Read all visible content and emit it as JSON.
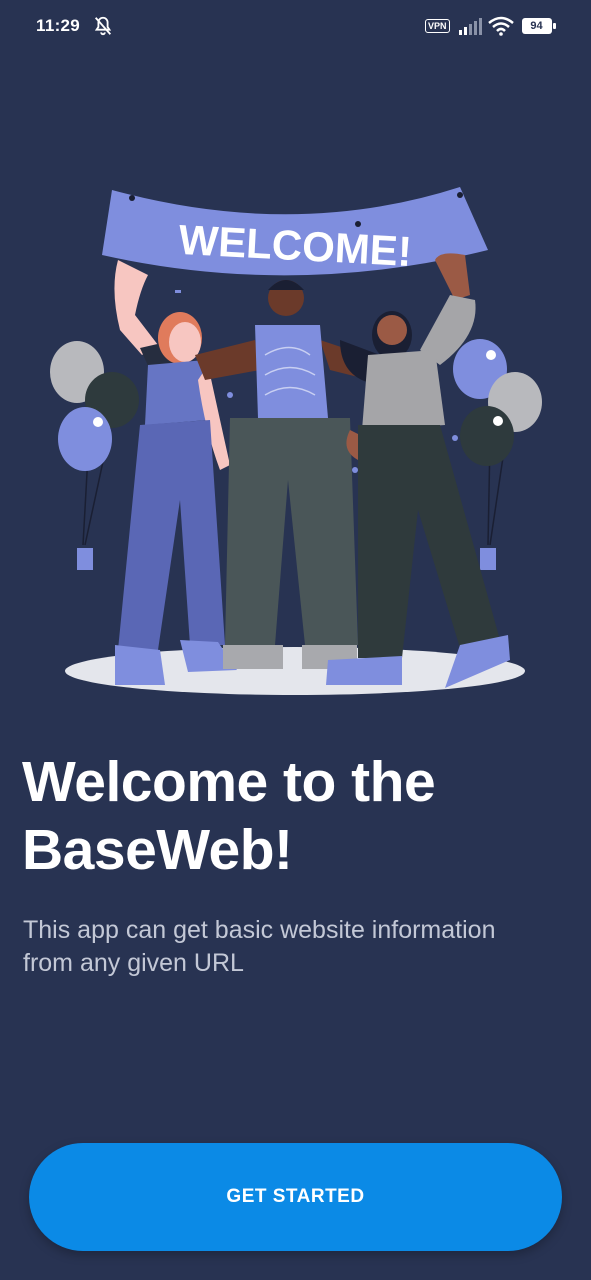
{
  "status_bar": {
    "time": "11:29",
    "vpn": "VPN",
    "battery": "94"
  },
  "illustration": {
    "banner_text": "WELCOME!"
  },
  "welcome": {
    "title": "Welcome to the BaseWeb!",
    "subtitle": "This app can get basic website information from any given URL"
  },
  "cta": {
    "label": "GET STARTED"
  },
  "colors": {
    "background": "#283352",
    "button": "#0b8ae6",
    "accent_purple": "#7f8ede"
  },
  "icons": [
    "bell-off-icon",
    "signal-icon",
    "wifi-icon",
    "battery-icon"
  ]
}
